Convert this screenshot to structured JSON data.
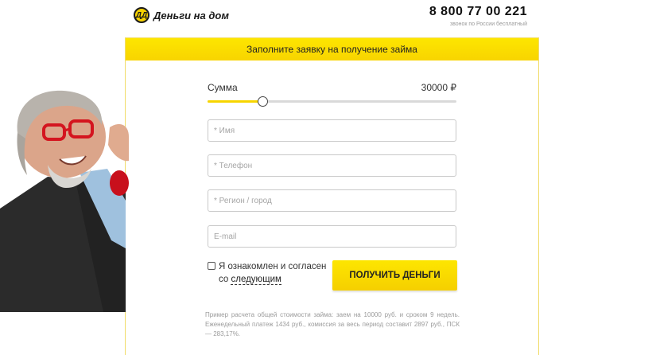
{
  "header": {
    "logo_mark": "ДД",
    "brand": "Деньги на дом",
    "phone": "8 800 77 00 221",
    "phone_note": "звонок по России бесплатный"
  },
  "form": {
    "title": "Заполните заявку на получение займа",
    "amount_label": "Сумма",
    "amount_value": "30000 ₽",
    "slider_fraction": 0.22,
    "colors": {
      "accent": "#f7d500",
      "track": "#d9d9d9"
    },
    "fields": {
      "name_placeholder": "* Имя",
      "phone_placeholder": "* Телефон",
      "region_placeholder": "* Регион / город",
      "email_placeholder": "E-mail"
    },
    "agree_text": "Я ознакомлен и согласен со ",
    "agree_link": "следующим",
    "submit_label": "ПОЛУЧИТЬ ДЕНЬГИ",
    "disclaimer": "Пример расчета общей стоимости займа: заем на 10000 руб. и сроком 9 недель. Еженедельный платеж 1434 руб., комиссия за весь период составит 2897 руб., ПСК — 283,17%."
  }
}
